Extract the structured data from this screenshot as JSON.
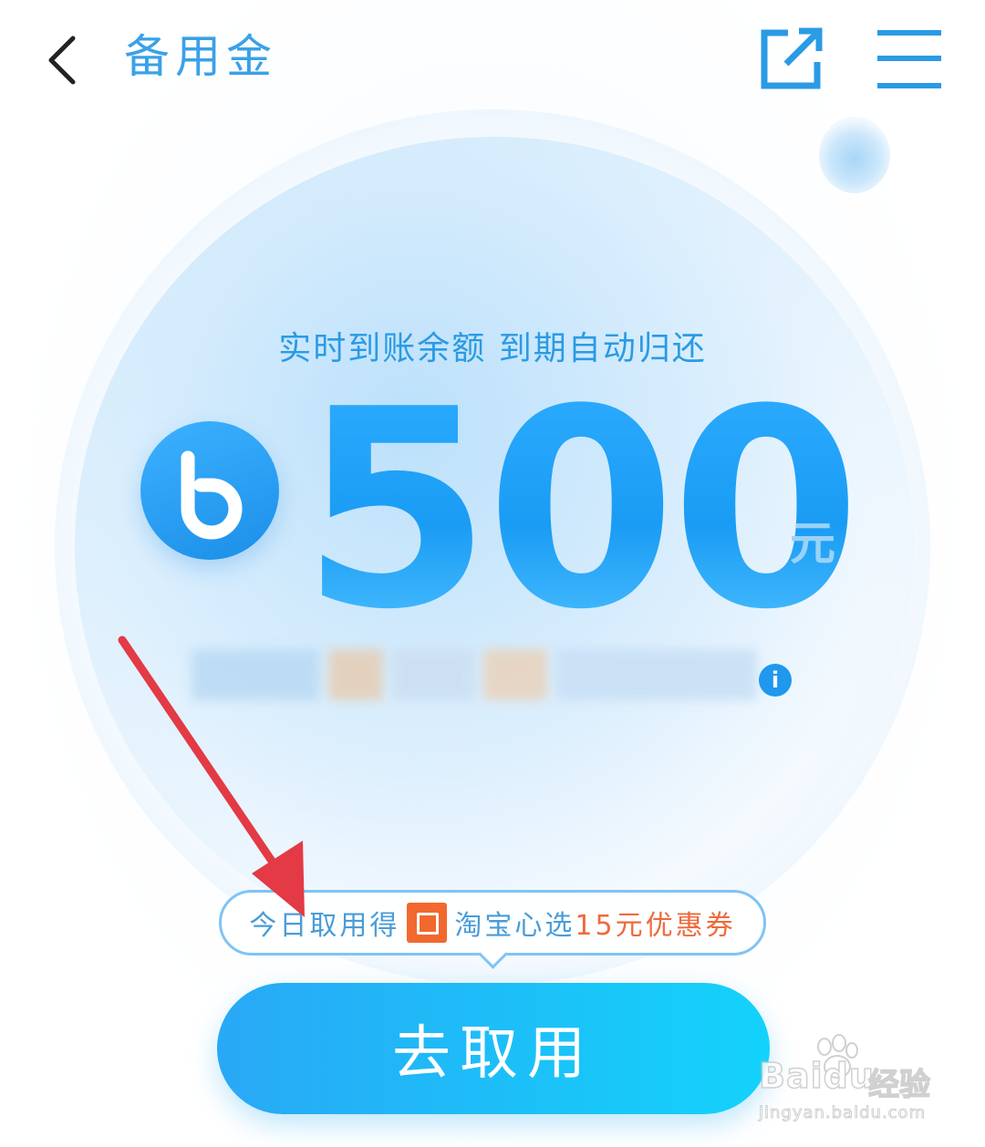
{
  "header": {
    "title": "备用金",
    "back_icon": "chevron-left-icon",
    "share_icon": "external-share-icon",
    "menu_icon": "hamburger-menu-icon"
  },
  "main": {
    "tagline": "实时到账余额 到期自动归还",
    "brand_icon": "blue-b-logo-icon",
    "amount": "500",
    "unit": "元",
    "info_icon_glyph": "i"
  },
  "promo": {
    "prefix": "今日取用得",
    "icon": "taobao-xinxuan-icon",
    "brand": "淘宝心选",
    "highlight": "15元优惠券"
  },
  "cta": {
    "label": "去取用"
  },
  "watermark": {
    "brand": "Baidu",
    "product": "经验",
    "url": "jingyan.baidu.com"
  },
  "colors": {
    "accent": "#2a9be4",
    "cta_start": "#29a8f6",
    "cta_end": "#14d2fb",
    "promo_highlight": "#ef6a3c",
    "annotation": "#e33a45"
  }
}
